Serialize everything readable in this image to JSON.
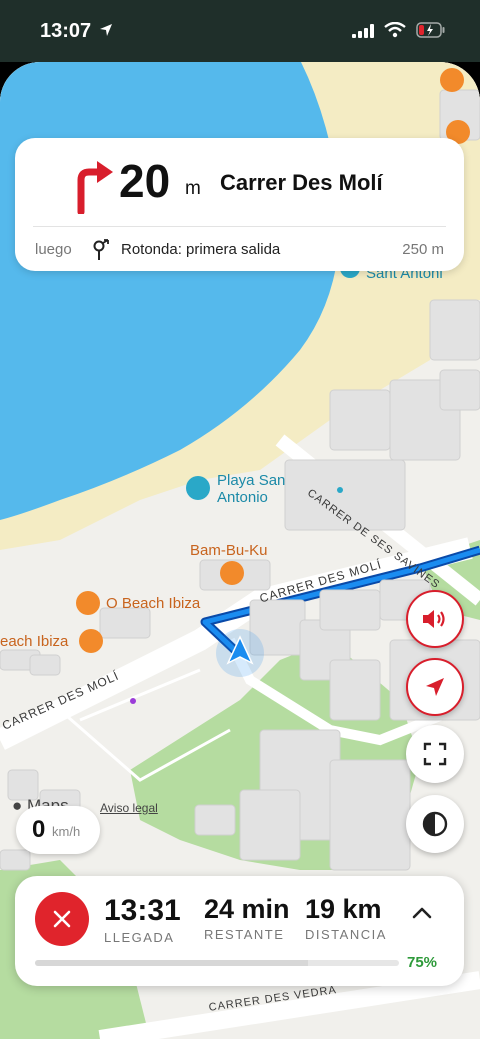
{
  "status_bar": {
    "time": "13:07"
  },
  "navigation": {
    "distance_value": "20",
    "distance_unit": "m",
    "street": "Carrer Des Molí",
    "then_label": "luego",
    "next_instruction": "Rotonda: primera salida",
    "next_distance": "250 m"
  },
  "map": {
    "pois": {
      "playa_line1": "Playa San",
      "playa_line2": "Antonio",
      "bambuku": "Bam-Bu-Ku",
      "obeach": "O Beach Ibiza",
      "obeach_partial": "each Ibiza",
      "sant_antoni": "Sant Antoni"
    },
    "streets": {
      "ses_savines": "CARRER DE SES SAVINES",
      "des_moli_upper": "CARRER DES MOLÍ",
      "des_moli_lower": "CARRER DES MOLÍ",
      "des_vedra": "CARRER DES VEDRA"
    },
    "logo_text": "Maps",
    "legal": "Aviso legal"
  },
  "speed": {
    "value": "0",
    "unit": "km/h"
  },
  "trip": {
    "arrival_time": "13:31",
    "arrival_label": "LLEGADA",
    "remaining_time": "24 min",
    "remaining_label": "RESTANTE",
    "distance": "19 km",
    "distance_label": "DISTANCIA",
    "progress_text": "75%",
    "progress_fraction": 0.75
  },
  "colors": {
    "accent_red": "#d81e2c",
    "route_blue": "#1a73e8",
    "progress_green": "#2e9a3a",
    "water": "#55b9ec",
    "beach": "#f4ecc4",
    "park": "#b5dca0"
  },
  "icons": {
    "turn": "turn-right-arrow-icon",
    "roundabout": "roundabout-icon",
    "volume": "speaker-icon",
    "locate": "location-arrow-icon",
    "fullscreen": "expand-icon",
    "theme": "contrast-icon",
    "close": "close-icon",
    "expand": "chevron-up-icon"
  }
}
